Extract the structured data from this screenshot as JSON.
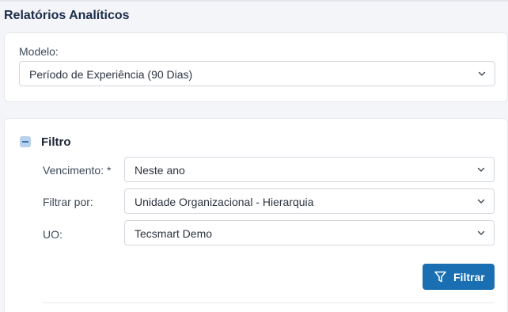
{
  "page": {
    "title": "Relatórios Analíticos"
  },
  "model": {
    "label": "Modelo:",
    "selected": "Período de Experiência (90 Dias)"
  },
  "filter": {
    "title": "Filtro",
    "fields": [
      {
        "label": "Vencimento: *",
        "value": "Neste ano"
      },
      {
        "label": "Filtrar por:",
        "value": "Unidade Organizacional - Hierarquia"
      },
      {
        "label": "UO:",
        "value": "Tecsmart Demo"
      }
    ],
    "button_label": "Filtrar"
  },
  "colors": {
    "accent": "#1a6fb2",
    "title": "#1c2c4a"
  },
  "icons": {
    "toggle": "minus-icon",
    "dropdown": "chevron-down-icon",
    "button": "funnel-icon"
  }
}
